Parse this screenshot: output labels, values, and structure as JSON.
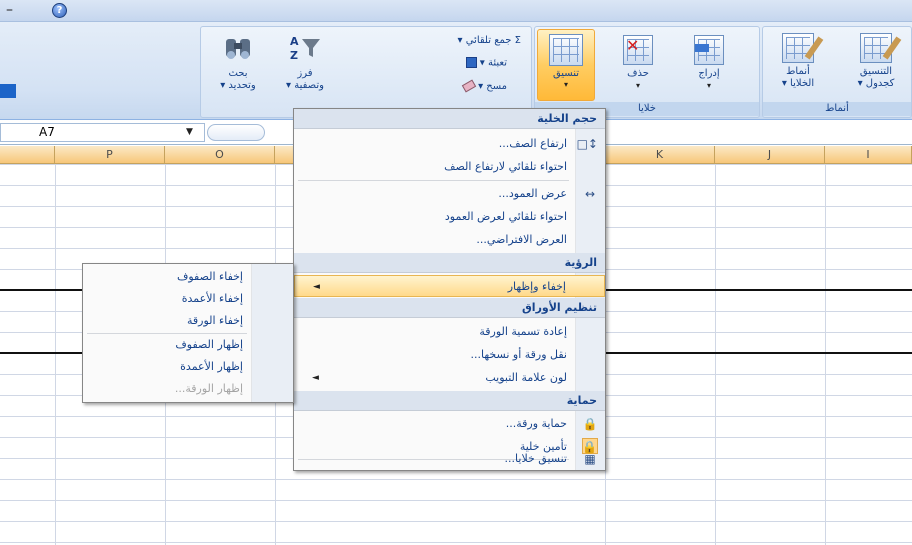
{
  "titlebar": {
    "minimize_glyph": "–",
    "help_icon": "help-icon"
  },
  "ribbon": {
    "groups": [
      {
        "id": "editing",
        "buttons": [
          {
            "label": "بحث\nوتحديد ▾"
          },
          {
            "label": "فرز\nوتصفية ▾"
          }
        ],
        "small": [
          {
            "label": "Σ جمع تلقائي ▾"
          },
          {
            "label": "تعبئة ▾"
          },
          {
            "label": "مسح ▾"
          }
        ]
      },
      {
        "id": "cells",
        "label": "خلايا",
        "buttons": [
          {
            "label": "تنسيق"
          },
          {
            "label": "حذف"
          },
          {
            "label": "إدراج"
          }
        ]
      },
      {
        "id": "styles",
        "label": "أنماط",
        "buttons": [
          {
            "label": "أنماط\nالخلايا ▾"
          },
          {
            "label": "التنسيق\nكجدول ▾"
          }
        ]
      }
    ]
  },
  "formulabar": {
    "name_box": "A7"
  },
  "columns": [
    "P",
    "O",
    "K",
    "J",
    "I"
  ],
  "format_menu": {
    "sections": [
      {
        "title": "حجم الخلية",
        "items": [
          {
            "label": "ارتفاع الصف...",
            "icon": "row-height-icon"
          },
          {
            "label": "احتواء تلقائي لارتفاع الصف"
          },
          {
            "label": "عرض العمود...",
            "icon": "column-width-icon"
          },
          {
            "label": "احتواء تلقائي لعرض العمود"
          },
          {
            "label": "العرض الافتراضي..."
          }
        ]
      },
      {
        "title": "الرؤية",
        "items": [
          {
            "label": "إخفاء وإظهار"
          }
        ]
      },
      {
        "title": "تنظيم الأوراق",
        "items": [
          {
            "label": "إعادة تسمية الورقة"
          },
          {
            "label": "نقل ورقة أو نسخها..."
          },
          {
            "label": "لون علامة التبويب"
          }
        ]
      },
      {
        "title": "حماية",
        "items": [
          {
            "label": "حماية ورقة...",
            "icon": "protect-sheet-icon"
          },
          {
            "label": "تأمين خلية",
            "icon": "lock-cell-icon"
          },
          {
            "label": "تنسيق خلايا...",
            "icon": "format-cells-icon"
          }
        ]
      }
    ]
  },
  "hide_submenu": {
    "items": [
      {
        "label": "إخفاء الصفوف"
      },
      {
        "label": "إخفاء الأعمدة"
      },
      {
        "label": "إخفاء الورقة"
      },
      {
        "label": "إظهار الصفوف"
      },
      {
        "label": "إظهار الأعمدة"
      },
      {
        "label": "إظهار الورقة..."
      }
    ]
  }
}
